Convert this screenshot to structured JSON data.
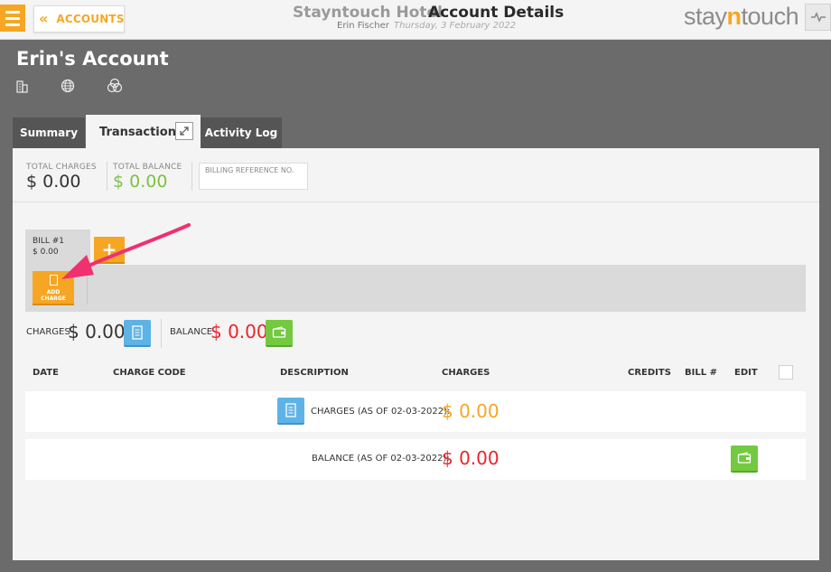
{
  "header": {
    "accounts_label": "ACCOUNTS",
    "hotel_name": "Stayntouch Hotel",
    "page_title": "Account Details",
    "user_name": "Erin Fischer",
    "date": "Thursday, 3 February 2022",
    "logo_part1": "stay",
    "logo_part2": "n",
    "logo_part3": "touch"
  },
  "account": {
    "title": "Erin's Account",
    "icons": [
      "building-icon",
      "globe-icon",
      "circles-icon"
    ]
  },
  "tabs": [
    {
      "label": "Summary",
      "active": false
    },
    {
      "label": "Transactions",
      "active": true
    },
    {
      "label": "Activity Log",
      "active": false
    }
  ],
  "summary": {
    "total_charges_label": "TOTAL CHARGES",
    "total_charges_value": "$ 0.00",
    "total_balance_label": "TOTAL BALANCE",
    "total_balance_value": "$ 0.00",
    "billing_ref_placeholder": "BILLING REFERENCE NO."
  },
  "bill": {
    "name": "BILL #1",
    "amount": "$ 0.00",
    "add_bill_symbol": "+",
    "add_charge_label_1": "ADD",
    "add_charge_label_2": "CHARGE"
  },
  "totals": {
    "charges_label": "CHARGES",
    "charges_value": "$ 0.00",
    "balance_label": "BALANCE",
    "balance_value": "$ 0.00"
  },
  "table": {
    "headers": [
      "DATE",
      "CHARGE CODE",
      "DESCRIPTION",
      "CHARGES",
      "CREDITS",
      "BILL #",
      "EDIT"
    ],
    "rows": [
      {
        "label": "CHARGES (AS OF 02-03-2022):",
        "value": "$ 0.00"
      },
      {
        "label": "BALANCE (AS OF 02-03-2022):",
        "value": "$ 0.00"
      }
    ]
  },
  "colors": {
    "accent": "#f6a623",
    "balance_red": "#e8262b",
    "balance_green": "#7dc242",
    "button_blue": "#5db3e6",
    "button_green": "#73c93f",
    "annotation_arrow": "#f0306f"
  }
}
